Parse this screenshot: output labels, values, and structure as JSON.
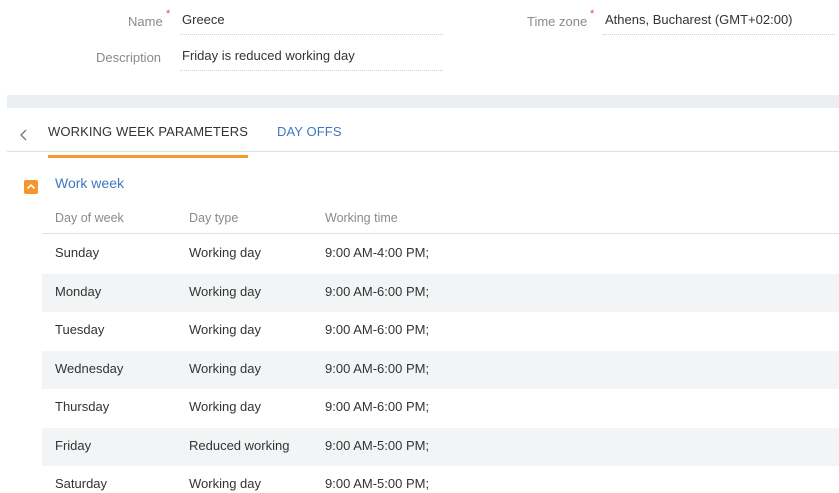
{
  "form": {
    "name_label": "Name",
    "name_value": "Greece",
    "timezone_label": "Time zone",
    "timezone_value": "Athens, Bucharest (GMT+02:00)",
    "description_label": "Description",
    "description_value": "Friday is reduced working day",
    "required_mark": "*"
  },
  "tabs": {
    "back_icon": "chevron-left-icon",
    "items": [
      {
        "label": "WORKING WEEK PARAMETERS",
        "active": true
      },
      {
        "label": "DAY OFFS",
        "active": false
      }
    ]
  },
  "group": {
    "title": "Work week",
    "toggle_icon": "chevron-up-icon",
    "toggle_color": "#f7952d",
    "link_color": "#3d79c1"
  },
  "grid": {
    "columns": [
      "Day of week",
      "Day type",
      "Working time"
    ],
    "rows": [
      {
        "day": "Sunday",
        "type": "Working day",
        "time": "9:00 AM-4:00 PM;"
      },
      {
        "day": "Monday",
        "type": "Working day",
        "time": "9:00 AM-6:00 PM;"
      },
      {
        "day": "Tuesday",
        "type": "Working day",
        "time": "9:00 AM-6:00 PM;"
      },
      {
        "day": "Wednesday",
        "type": "Working day",
        "time": "9:00 AM-6:00 PM;"
      },
      {
        "day": "Thursday",
        "type": "Working day",
        "time": "9:00 AM-6:00 PM;"
      },
      {
        "day": "Friday",
        "type": "Reduced working",
        "time": "9:00 AM-5:00 PM;"
      },
      {
        "day": "Saturday",
        "type": "Working day",
        "time": "9:00 AM-5:00 PM;"
      }
    ]
  }
}
